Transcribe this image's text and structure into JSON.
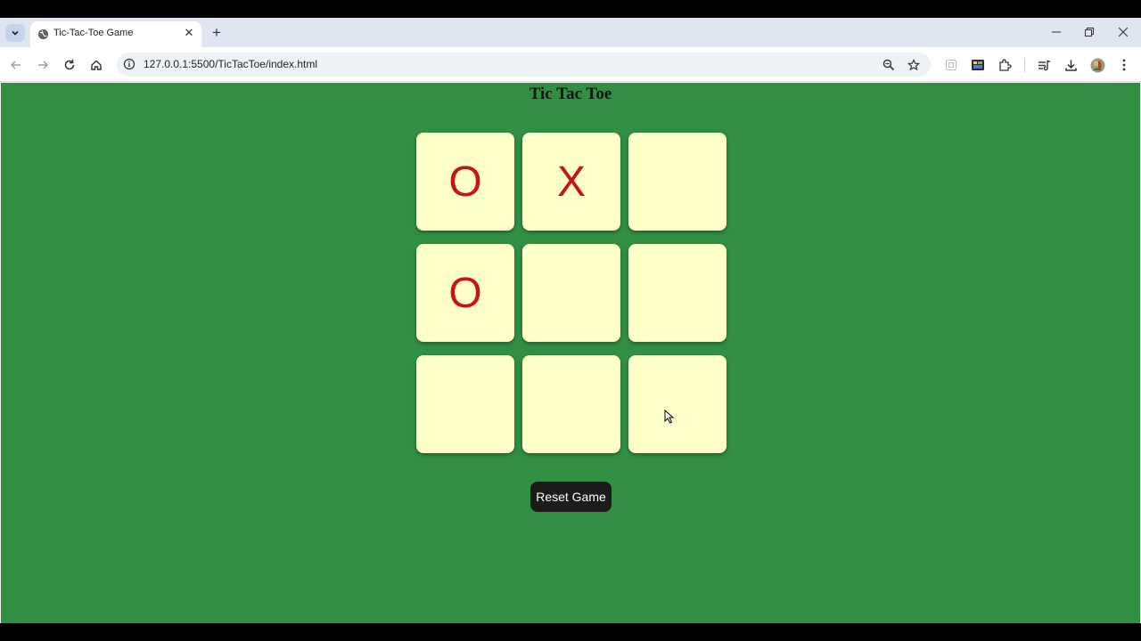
{
  "browser": {
    "tab": {
      "title": "Tic-Tac-Toe Game"
    },
    "address_bar": {
      "url": "127.0.0.1:5500/TicTacToe/index.html"
    }
  },
  "page": {
    "heading": "Tic Tac Toe",
    "board": {
      "cells": [
        "O",
        "X",
        "",
        "O",
        "",
        "",
        "",
        "",
        ""
      ]
    },
    "reset_button": "Reset Game"
  },
  "colors": {
    "page_background": "#318f43",
    "cell_background": "#feffc9",
    "mark_color": "#c81414",
    "button_background": "#1b1b1b"
  },
  "icons": {
    "tab_menu": "chevron-down-icon",
    "favicon": "globe-icon",
    "tab_close": "close-icon",
    "new_tab": "plus-icon",
    "back": "arrow-left-icon",
    "forward": "arrow-right-icon",
    "reload": "reload-icon",
    "home": "home-icon",
    "site_info": "info-icon",
    "zoom": "zoom-icon",
    "bookmark": "star-icon",
    "extensions": "puzzle-icon",
    "reading_list": "reading-list-icon",
    "downloads": "download-icon",
    "profile": "avatar",
    "menu": "kebab-menu-icon"
  }
}
